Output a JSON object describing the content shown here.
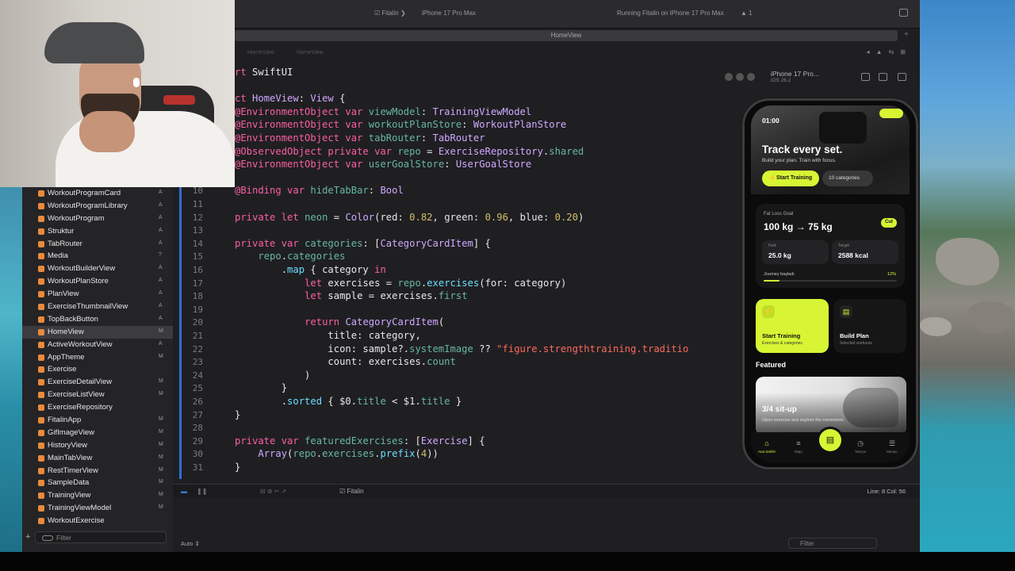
{
  "window": {
    "scheme": "Fitalin",
    "destination": "iPhone 17 Pro Max",
    "status": "Running Fitalin on iPhone 17 Pro Max",
    "warnings": "1",
    "tab_title": "HomeView"
  },
  "jumpbar": {
    "items": [
      "HomeView",
      "HomeView"
    ]
  },
  "navigator": {
    "items": [
      {
        "label": "WorkoutProgramCard",
        "status": "A"
      },
      {
        "label": "WorkoutProgramLibrary",
        "status": "A"
      },
      {
        "label": "WorkoutProgram",
        "status": "A"
      },
      {
        "label": "Struktur",
        "status": "A"
      },
      {
        "label": "TabRouter",
        "status": "A"
      },
      {
        "label": "Media",
        "status": "?"
      },
      {
        "label": "WorkoutBuilderView",
        "status": "A"
      },
      {
        "label": "WorkoutPlanStore",
        "status": "A"
      },
      {
        "label": "PlanView",
        "status": "A"
      },
      {
        "label": "ExerciseThumbnailView",
        "status": "A"
      },
      {
        "label": "TopBackButton",
        "status": "A"
      },
      {
        "label": "HomeView",
        "status": "M"
      },
      {
        "label": "ActiveWorkoutView",
        "status": "A"
      },
      {
        "label": "AppTheme",
        "status": "M"
      },
      {
        "label": "Exercise",
        "status": ""
      },
      {
        "label": "ExerciseDetailView",
        "status": "M"
      },
      {
        "label": "ExerciseListView",
        "status": "M"
      },
      {
        "label": "ExerciseRepository",
        "status": ""
      },
      {
        "label": "FitalinApp",
        "status": "M"
      },
      {
        "label": "GifImageView",
        "status": "M"
      },
      {
        "label": "HistoryView",
        "status": "M"
      },
      {
        "label": "MainTabView",
        "status": "M"
      },
      {
        "label": "RestTimerView",
        "status": "M"
      },
      {
        "label": "SampleData",
        "status": "M"
      },
      {
        "label": "TrainingView",
        "status": "M"
      },
      {
        "label": "TrainingViewModel",
        "status": "M"
      },
      {
        "label": "WorkoutExercise",
        "status": ""
      }
    ],
    "filter_placeholder": "Filter"
  },
  "editor": {
    "lines": [
      {
        "n": "",
        "tokens": [
          [
            "kw",
            "rt "
          ],
          [
            "",
            "SwiftUI"
          ]
        ]
      },
      {
        "n": "",
        "tokens": []
      },
      {
        "n": "",
        "tokens": [
          [
            "kw",
            "ct "
          ],
          [
            "ty",
            "HomeView"
          ],
          [
            "",
            ": "
          ],
          [
            "ty",
            "View"
          ],
          [
            "",
            " {"
          ]
        ]
      },
      {
        "n": "",
        "tokens": [
          [
            "kw",
            "@EnvironmentObject var "
          ],
          [
            "pr",
            "viewModel"
          ],
          [
            "",
            ": "
          ],
          [
            "ty",
            "TrainingViewModel"
          ]
        ]
      },
      {
        "n": "",
        "tokens": [
          [
            "kw",
            "@EnvironmentObject var "
          ],
          [
            "pr",
            "workoutPlanStore"
          ],
          [
            "",
            ": "
          ],
          [
            "ty",
            "WorkoutPlanStore"
          ]
        ]
      },
      {
        "n": "",
        "tokens": [
          [
            "kw",
            "@EnvironmentObject var "
          ],
          [
            "pr",
            "tabRouter"
          ],
          [
            "",
            ": "
          ],
          [
            "ty",
            "TabRouter"
          ]
        ]
      },
      {
        "n": "",
        "tokens": [
          [
            "kw",
            "@ObservedObject private var "
          ],
          [
            "pr",
            "repo"
          ],
          [
            "",
            " = "
          ],
          [
            "ty",
            "ExerciseRepository"
          ],
          [
            "",
            "."
          ],
          [
            "pr",
            "shared"
          ]
        ]
      },
      {
        "n": "",
        "tokens": [
          [
            "kw",
            "@EnvironmentObject var "
          ],
          [
            "pr",
            "userGoalStore"
          ],
          [
            "",
            ": "
          ],
          [
            "ty",
            "UserGoalStore"
          ]
        ]
      },
      {
        "n": "",
        "tokens": []
      },
      {
        "n": "10",
        "tokens": [
          [
            "kw",
            "@Binding var "
          ],
          [
            "pr",
            "hideTabBar"
          ],
          [
            "",
            ": "
          ],
          [
            "ty",
            "Bool"
          ]
        ]
      },
      {
        "n": "11",
        "tokens": []
      },
      {
        "n": "12",
        "tokens": [
          [
            "kw",
            "private let "
          ],
          [
            "pr",
            "neon"
          ],
          [
            "",
            " = "
          ],
          [
            "ty",
            "Color"
          ],
          [
            "",
            "(red: "
          ],
          [
            "nm",
            "0.82"
          ],
          [
            "",
            ", green: "
          ],
          [
            "nm",
            "0.96"
          ],
          [
            "",
            ", blue: "
          ],
          [
            "nm",
            "0.20"
          ],
          [
            "",
            ")"
          ]
        ]
      },
      {
        "n": "13",
        "tokens": []
      },
      {
        "n": "14",
        "tokens": [
          [
            "kw",
            "private var "
          ],
          [
            "pr",
            "categories"
          ],
          [
            "",
            ": ["
          ],
          [
            "ty",
            "CategoryCardItem"
          ],
          [
            "",
            "] {"
          ]
        ]
      },
      {
        "n": "15",
        "tokens": [
          [
            "",
            "    "
          ],
          [
            "pr",
            "repo"
          ],
          [
            "",
            "."
          ],
          [
            "pr",
            "categories"
          ]
        ]
      },
      {
        "n": "16",
        "tokens": [
          [
            "",
            "        ."
          ],
          [
            "fn",
            "map"
          ],
          [
            "",
            " { category "
          ],
          [
            "kw",
            "in"
          ]
        ]
      },
      {
        "n": "17",
        "tokens": [
          [
            "",
            "            "
          ],
          [
            "kw",
            "let "
          ],
          [
            "",
            "exercises = "
          ],
          [
            "pr",
            "repo"
          ],
          [
            "",
            "."
          ],
          [
            "fn",
            "exercises"
          ],
          [
            "",
            "(for: category)"
          ]
        ]
      },
      {
        "n": "18",
        "tokens": [
          [
            "",
            "            "
          ],
          [
            "kw",
            "let "
          ],
          [
            "",
            "sample = exercises."
          ],
          [
            "pr",
            "first"
          ]
        ]
      },
      {
        "n": "19",
        "tokens": []
      },
      {
        "n": "20",
        "tokens": [
          [
            "",
            "            "
          ],
          [
            "kw",
            "return "
          ],
          [
            "ty",
            "CategoryCardItem"
          ],
          [
            "",
            "("
          ]
        ]
      },
      {
        "n": "21",
        "tokens": [
          [
            "",
            "                title: category,"
          ]
        ]
      },
      {
        "n": "22",
        "tokens": [
          [
            "",
            "                icon: sample?."
          ],
          [
            "pr",
            "systemImage"
          ],
          [
            "",
            " ?? "
          ],
          [
            "st",
            "\"figure.strengthtraining.traditio"
          ]
        ]
      },
      {
        "n": "23",
        "tokens": [
          [
            "",
            "                count: exercises."
          ],
          [
            "pr",
            "count"
          ]
        ]
      },
      {
        "n": "24",
        "tokens": [
          [
            "",
            "            )"
          ]
        ]
      },
      {
        "n": "25",
        "tokens": [
          [
            "",
            "        }"
          ]
        ]
      },
      {
        "n": "26",
        "tokens": [
          [
            "",
            "        ."
          ],
          [
            "fn",
            "sorted"
          ],
          [
            "",
            " { $0."
          ],
          [
            "pr",
            "title"
          ],
          [
            "",
            " < $1."
          ],
          [
            "pr",
            "title"
          ],
          [
            "",
            " }"
          ]
        ]
      },
      {
        "n": "27",
        "tokens": [
          [
            "",
            "}"
          ]
        ]
      },
      {
        "n": "28",
        "tokens": []
      },
      {
        "n": "29",
        "tokens": [
          [
            "kw",
            "private var "
          ],
          [
            "pr",
            "featuredExercises"
          ],
          [
            "",
            ": ["
          ],
          [
            "ty",
            "Exercise"
          ],
          [
            "",
            "] {"
          ]
        ]
      },
      {
        "n": "30",
        "tokens": [
          [
            "",
            "    "
          ],
          [
            "ty",
            "Array"
          ],
          [
            "",
            "("
          ],
          [
            "pr",
            "repo"
          ],
          [
            "",
            "."
          ],
          [
            "pr",
            "exercises"
          ],
          [
            "",
            "."
          ],
          [
            "fn",
            "prefix"
          ],
          [
            "",
            "("
          ],
          [
            "nm",
            "4"
          ],
          [
            "",
            "))"
          ]
        ]
      },
      {
        "n": "31",
        "tokens": [
          [
            "",
            "}"
          ]
        ]
      }
    ]
  },
  "debug": {
    "target": "Fitalin",
    "cursor": "Line: 8  Col: 56"
  },
  "console": {
    "mode": "Auto",
    "filter_placeholder": "Filter"
  },
  "simulator": {
    "device": "iPhone 17 Pro...",
    "os": "iOS 26.2",
    "app": {
      "time": "01:00",
      "hero_title": "Track every set.",
      "hero_sub": "Build your plan. Train with focus.",
      "start_btn": "Start Training",
      "categories_btn": "10 categories",
      "goal_label": "Fat Loss Goal",
      "goal_value": "100 kg → 75 kg",
      "goal_tag": "Cut",
      "stat1_label": "Fark",
      "stat1_value": "25.0 kg",
      "stat2_label": "Target",
      "stat2_value": "2588 kcal",
      "journey_label": "Journey başladı",
      "journey_pct": "12%",
      "journey_progress": 0.12,
      "card1_title": "Start Training",
      "card1_sub": "Exercises & categories",
      "card2_title": "Build Plan",
      "card2_sub": "Selected workouts",
      "featured_title": "Featured",
      "featured_name": "3/4 sit-up",
      "featured_sub": "Open exercise and explore the movement.",
      "tabs": [
        {
          "label": "Ana Sahife",
          "icon": "⌂"
        },
        {
          "label": "Miqo",
          "icon": "≡"
        },
        {
          "label": "",
          "icon": ""
        },
        {
          "label": "Tarixçe",
          "icon": "◷"
        },
        {
          "label": "Menyu",
          "icon": "☰"
        }
      ]
    }
  },
  "colors": {
    "neon": "#d7f534",
    "editor_bg": "#1f1f22",
    "keyword": "#fc5fa3",
    "type": "#d0a8ff"
  }
}
